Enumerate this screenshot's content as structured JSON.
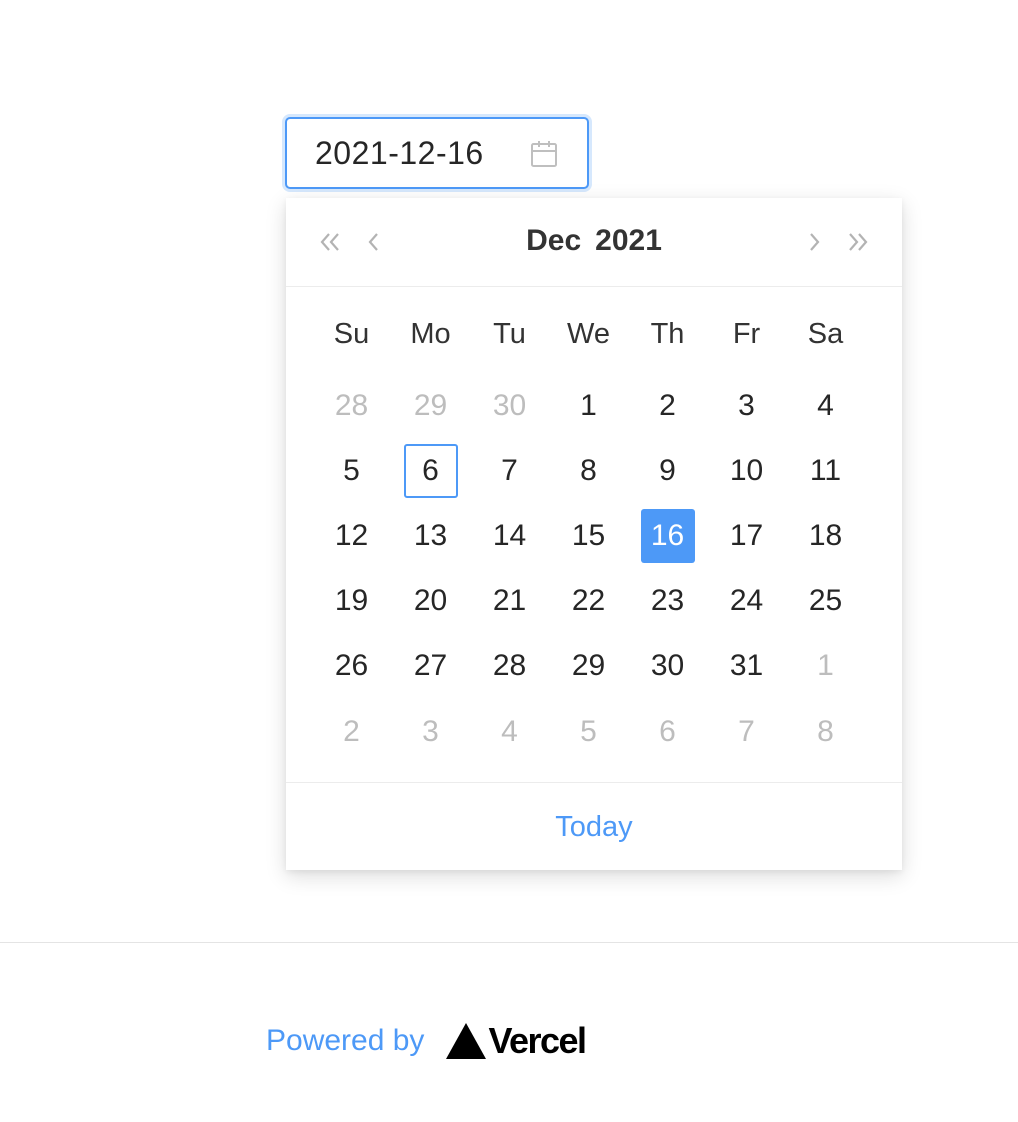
{
  "date_input": {
    "value": "2021-12-16",
    "icon": "calendar-icon"
  },
  "calendar": {
    "header": {
      "month": "Dec",
      "year": "2021",
      "prev_year_icon": "double-chevron-left-icon",
      "prev_month_icon": "chevron-left-icon",
      "next_month_icon": "chevron-right-icon",
      "next_year_icon": "double-chevron-right-icon"
    },
    "weekdays": [
      "Su",
      "Mo",
      "Tu",
      "We",
      "Th",
      "Fr",
      "Sa"
    ],
    "weeks": [
      [
        {
          "d": "28",
          "other": true
        },
        {
          "d": "29",
          "other": true
        },
        {
          "d": "30",
          "other": true
        },
        {
          "d": "1"
        },
        {
          "d": "2"
        },
        {
          "d": "3"
        },
        {
          "d": "4"
        }
      ],
      [
        {
          "d": "5"
        },
        {
          "d": "6",
          "today": true
        },
        {
          "d": "7"
        },
        {
          "d": "8"
        },
        {
          "d": "9"
        },
        {
          "d": "10"
        },
        {
          "d": "11"
        }
      ],
      [
        {
          "d": "12"
        },
        {
          "d": "13"
        },
        {
          "d": "14"
        },
        {
          "d": "15"
        },
        {
          "d": "16",
          "selected": true
        },
        {
          "d": "17"
        },
        {
          "d": "18"
        }
      ],
      [
        {
          "d": "19"
        },
        {
          "d": "20"
        },
        {
          "d": "21"
        },
        {
          "d": "22"
        },
        {
          "d": "23"
        },
        {
          "d": "24"
        },
        {
          "d": "25"
        }
      ],
      [
        {
          "d": "26"
        },
        {
          "d": "27"
        },
        {
          "d": "28"
        },
        {
          "d": "29"
        },
        {
          "d": "30"
        },
        {
          "d": "31"
        },
        {
          "d": "1",
          "other": true
        }
      ],
      [
        {
          "d": "2",
          "other": true
        },
        {
          "d": "3",
          "other": true
        },
        {
          "d": "4",
          "other": true
        },
        {
          "d": "5",
          "other": true
        },
        {
          "d": "6",
          "other": true
        },
        {
          "d": "7",
          "other": true
        },
        {
          "d": "8",
          "other": true
        }
      ]
    ],
    "footer": {
      "today_label": "Today"
    }
  },
  "footer": {
    "powered_by": "Powered by",
    "brand": "Vercel"
  },
  "colors": {
    "accent": "#4d99f7",
    "text": "#262626",
    "muted": "#bdbdbd"
  }
}
